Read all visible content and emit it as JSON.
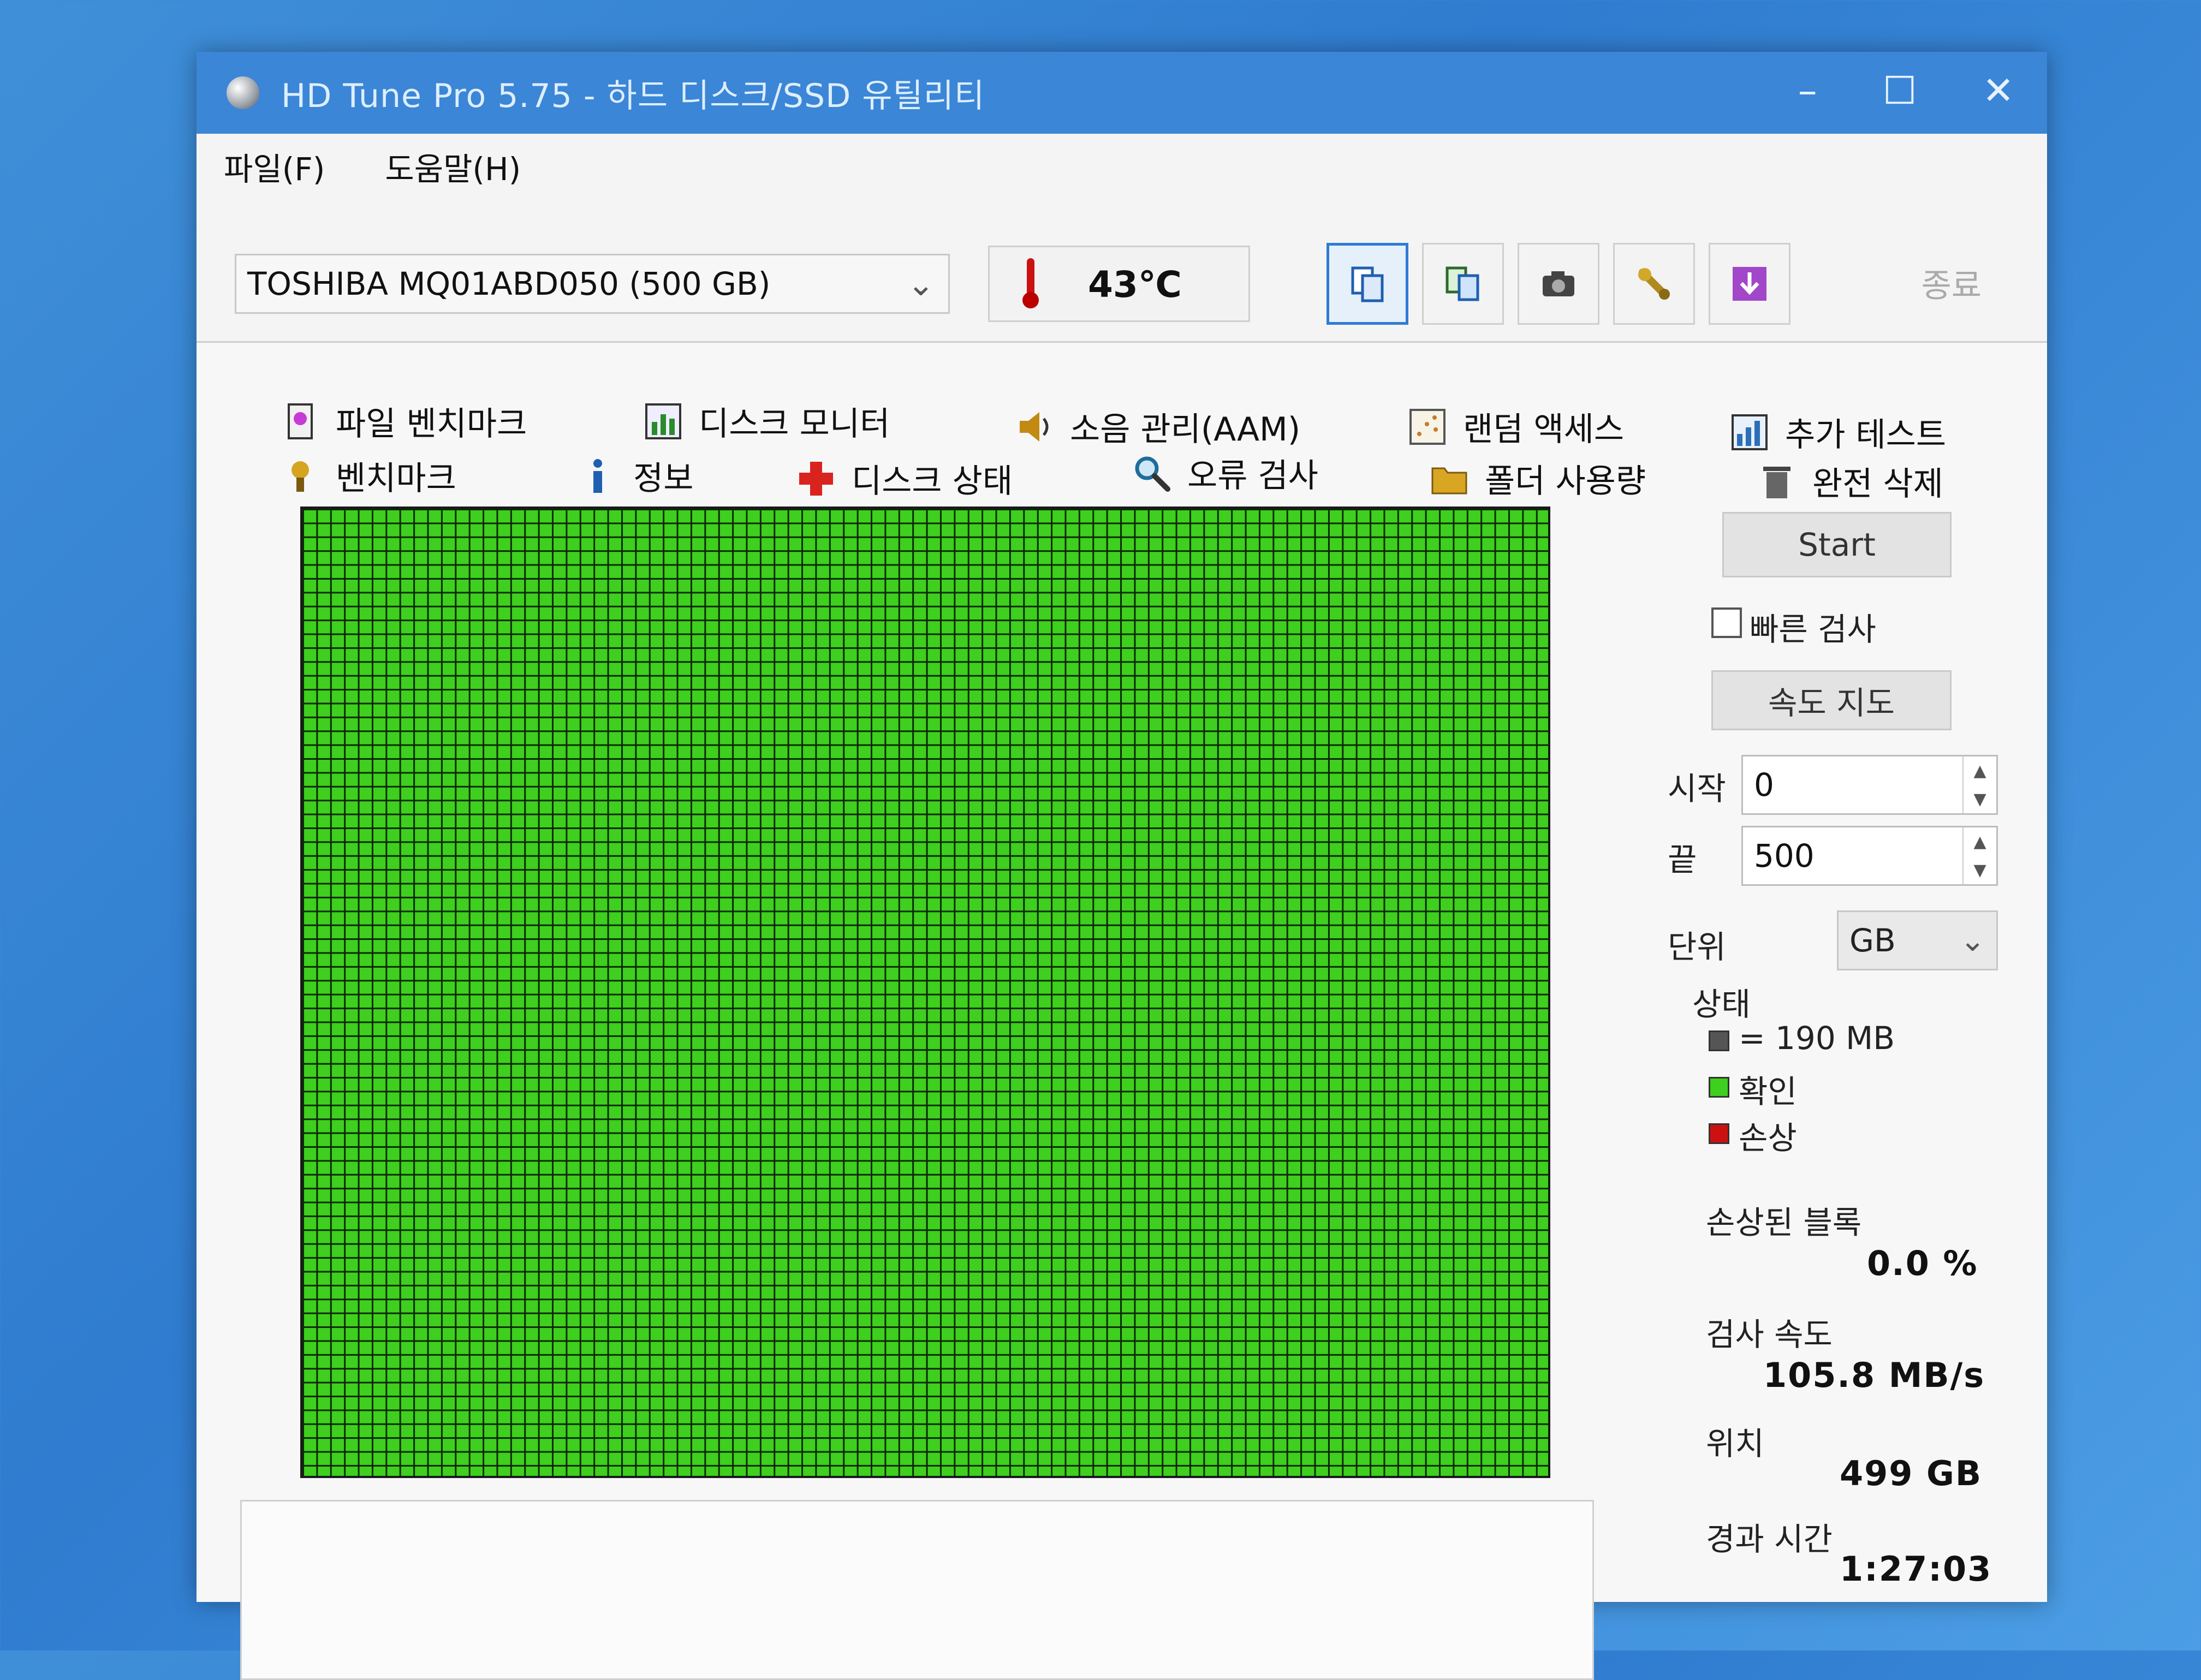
{
  "window": {
    "title": "HD Tune Pro 5.75 - 하드 디스크/SSD 유틸리티"
  },
  "menu": {
    "file": "파일(F)",
    "help": "도움말(H)"
  },
  "toolbar": {
    "drive": "TOSHIBA MQ01ABD050 (500 GB)",
    "temperature": "43℃",
    "exit_label": "종료"
  },
  "tabs": {
    "row1": [
      "파일 벤치마크",
      "디스크 모니터",
      "소음 관리(AAM)",
      "랜덤 액세스",
      "추가 테스트"
    ],
    "row2": [
      "벤치마크",
      "정보",
      "디스크 상태",
      "오류 검사",
      "폴더 사용량",
      "완전 삭제"
    ]
  },
  "side": {
    "start_label": "Start",
    "quick_scan_label": "빠른 검사",
    "speed_map_label": "속도 지도",
    "start_field_label": "시작",
    "start_value": "0",
    "end_field_label": "끝",
    "end_value": "500",
    "unit_label": "단위",
    "unit_value": "GB",
    "status_title": "상태",
    "legend_block": "= 190 MB",
    "legend_ok": "확인",
    "legend_damaged": "손상",
    "damaged_blocks_label": "손상된 블록",
    "damaged_blocks_value": "0.0 %",
    "scan_speed_label": "검사 속도",
    "scan_speed_value": "105.8 MB/s",
    "position_label": "위치",
    "position_value": "499 GB",
    "elapsed_label": "경과 시간",
    "elapsed_value": "1:27:03"
  },
  "colors": {
    "block_ok": "#3fcf1e",
    "block_damaged": "#cc1111",
    "block_unit": "#555555",
    "accent": "#2e7bd6"
  }
}
